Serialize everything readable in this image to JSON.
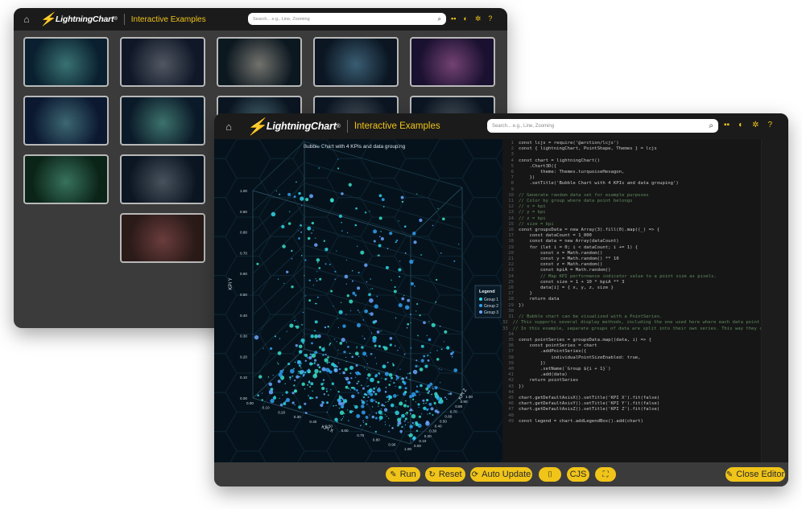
{
  "colors": {
    "accent": "#f0c419",
    "toolbar": "#1b1b1b",
    "window": "#3b3b3b",
    "chart_bg": "#05121c",
    "point": "#38d6f0"
  },
  "back_window": {
    "logo_text": "LightningChart",
    "logo_mark": "®",
    "title": "Interactive Examples",
    "search_placeholder": "Search... e.g., Line, Zooming",
    "thumbnails": [
      "point-cloud-3d",
      "line-traces",
      "box-3d",
      "surface-3d",
      "heatmap-surface",
      "dashboard-spectrogram",
      "bar-3d-peak",
      "surface-3d-2",
      "chart-partial",
      "chart-partial-2",
      "spectrogram-3d",
      "polar-circle",
      "radar-chart",
      "world-map",
      "",
      "",
      "earth-heatmap",
      "world-map-dark"
    ]
  },
  "front_window": {
    "logo_text": "LightningChart",
    "logo_mark": "®",
    "title": "Interactive Examples",
    "search_placeholder": "Search... e.g., Line, Zooming",
    "chart_title": "Bubble Chart with 4 KPIs and data grouping",
    "legend_title": "Legend",
    "legend_items": [
      "Group 1",
      "Group 2",
      "Group 3"
    ],
    "axis_y": "KPI Y",
    "axis_x": "KPI X",
    "axis_z": "KPI Z",
    "y_ticks": [
      "1.00",
      "0.90",
      "0.80",
      "0.70",
      "0.60",
      "0.50",
      "0.40",
      "0.30",
      "0.20",
      "0.10",
      "0.00"
    ],
    "x_ticks": [
      "0.00",
      "0.10",
      "0.20",
      "0.30",
      "0.40",
      "0.50",
      "0.60",
      "0.70",
      "0.80",
      "0.90",
      "1.00"
    ],
    "z_ticks": [
      "0.00",
      "0.10",
      "0.20",
      "0.30",
      "0.40",
      "0.50",
      "0.60",
      "0.70",
      "0.80",
      "0.90",
      "1.00"
    ],
    "code_lines": [
      "const lcjs = require('@arction/lcjs')",
      "const { lightningChart, PointShape, Themes } = lcjs",
      "",
      "const chart = lightningChart()",
      "    .Chart3D({",
      "        theme: Themes.turquoiseHexagon,",
      "    })",
      "    .setTitle('Bubble Chart with 4 KPIs and data grouping')",
      "",
      "// Generate random data set for example purposes",
      "// Color by group where data point belongs",
      "// x = kpi",
      "// y = kpi",
      "// z = kpi",
      "// size = kpi",
      "const groupsData = new Array(3).fill(0).map((_) => {",
      "    const dataCount = 1_000",
      "    const data = new Array(dataCount)",
      "    for (let i = 0; i < dataCount; i += 1) {",
      "        const x = Math.random()",
      "        const y = Math.random() ** 10",
      "        const z = Math.random()",
      "        const kpiA = Math.random()",
      "        // Map KPI performance indicator value to a point size as pixels.",
      "        const size = 1 + 10 * kpiA ** 3",
      "        data[i] = { x, y, z, size }",
      "    }",
      "    return data",
      "})",
      "",
      "// Bubble chart can be visualized with a PointSeries.",
      "// This supports several display methods, including the one used here where each data point has an individual size.",
      "// In this example, separate groups of data are split into their own series. This way they can be toggled",
      "",
      "const pointSeries = groupsData.map((data, i) => {",
      "    const pointSeries = chart",
      "        .addPointSeries({",
      "            individualPointSizeEnabled: true,",
      "        })",
      "        .setName(`Group ${i + 1}`)",
      "        .add(data)",
      "    return pointSeries",
      "})",
      "",
      "chart.getDefaultAxisX().setTitle('KPI X').fit(false)",
      "chart.getDefaultAxisY().setTitle('KPI Y').fit(false)",
      "chart.getDefaultAxisZ().setTitle('KPI Z').fit(false)",
      "",
      "const legend = chart.addLegendBox().add(chart)"
    ],
    "buttons": {
      "run": "Run",
      "reset": "Reset",
      "auto_update": "Auto Update",
      "cjs": "CJS",
      "close_editor": "Close Editor"
    }
  }
}
